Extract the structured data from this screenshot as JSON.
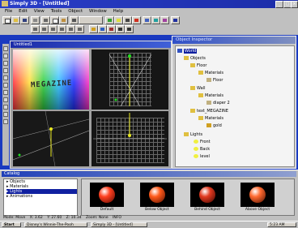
{
  "window": {
    "title": "Simply 3D - [Untitled]"
  },
  "menu": [
    "File",
    "Edit",
    "View",
    "Tools",
    "Object",
    "Window",
    "Help"
  ],
  "viewport_window": {
    "title": "Untitled1"
  },
  "megazine_text": "MEGAZINE",
  "object_tree": {
    "title": "Object Inspector",
    "nodes": [
      {
        "label": "World",
        "depth": 0
      },
      {
        "label": "Objects",
        "depth": 1
      },
      {
        "label": "Floor",
        "depth": 2
      },
      {
        "label": "Materials",
        "depth": 3
      },
      {
        "label": "Floor",
        "depth": 4
      },
      {
        "label": "Wall",
        "depth": 2
      },
      {
        "label": "Materials",
        "depth": 3
      },
      {
        "label": "diaper 2",
        "depth": 4
      },
      {
        "label": "text_MEGAZINE",
        "depth": 2
      },
      {
        "label": "Materials",
        "depth": 3
      },
      {
        "label": "gold",
        "depth": 4
      },
      {
        "label": "Lights",
        "depth": 1
      },
      {
        "label": "Front",
        "depth": 2
      },
      {
        "label": "Back",
        "depth": 2
      },
      {
        "label": "level",
        "depth": 2
      }
    ]
  },
  "catalog": {
    "title": "Catalog",
    "items": [
      "Objects",
      "Materials",
      "Lights",
      "Animations"
    ],
    "materials": [
      {
        "label": "Default",
        "color": "#ff4020"
      },
      {
        "label": "Below Object",
        "color": "#ff5a1a"
      },
      {
        "label": "Behind Object",
        "color": "#e23a20"
      },
      {
        "label": "Above Object",
        "color": "#ff6a30"
      }
    ]
  },
  "status": {
    "mode": "Mode: Move",
    "x": "X: 3.62",
    "y": "Y: 27.60",
    "z": "Z: 10.34",
    "zoom": "Zoom: None",
    "info": "INFO"
  },
  "taskbar": {
    "start": "Start",
    "items": [
      "Disney's Winnie-The-Pooh",
      "Simply 3D - [Untitled]"
    ],
    "clock": "5:23 AM"
  },
  "colors": {
    "titlebar": "#1c2da8",
    "workspace": "#1a3ac0",
    "chrome": "#c0c0c0"
  }
}
